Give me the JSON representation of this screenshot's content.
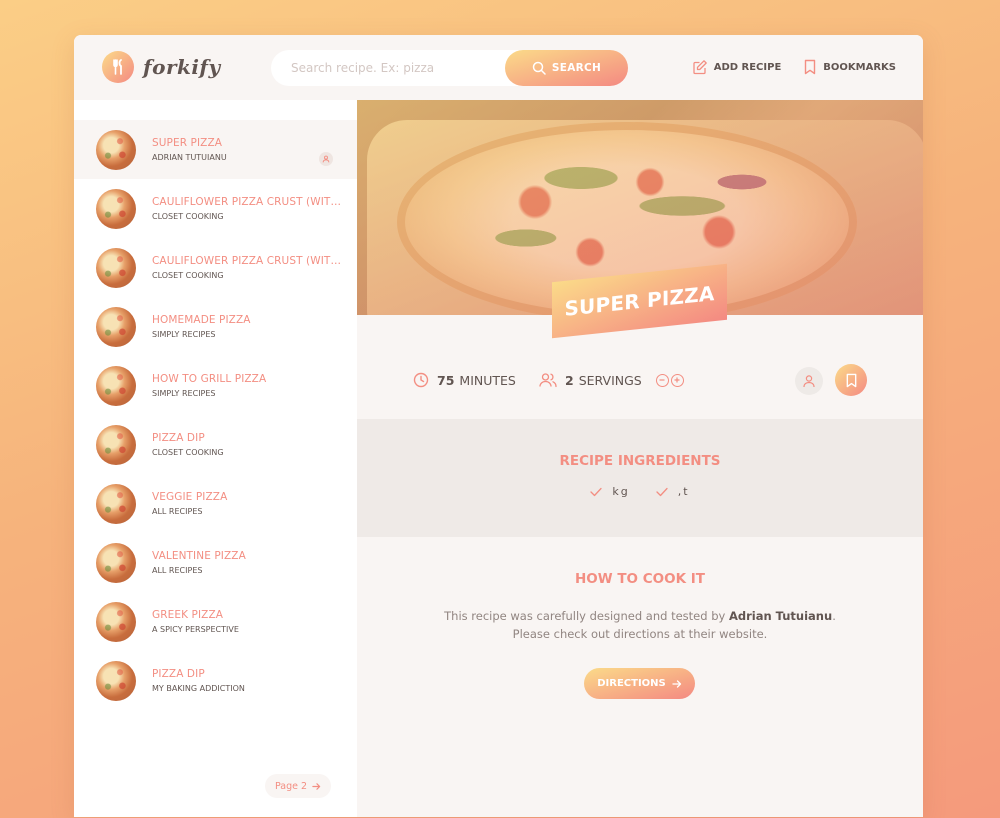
{
  "app": {
    "name": "forkify"
  },
  "colors": {
    "accent_start": "#fbdb89",
    "accent_end": "#f48982",
    "primary_text": "#615551",
    "title_pink": "#f38e82"
  },
  "search": {
    "placeholder": "Search recipe. Ex: pizza",
    "value": "",
    "button_label": "SEARCH"
  },
  "nav": {
    "add_recipe": "ADD RECIPE",
    "bookmarks": "BOOKMARKS"
  },
  "results": [
    {
      "title": "SUPER PIZZA",
      "publisher": "ADRIAN TUTUIANU",
      "active": true,
      "user_generated": true
    },
    {
      "title": "CAULIFLOWER PIZZA CRUST (WITH BBQ CHICKEN PIZZA)",
      "publisher": "CLOSET COOKING"
    },
    {
      "title": "CAULIFLOWER PIZZA CRUST (WITH BBQ CHICKEN PIZZA)",
      "publisher": "CLOSET COOKING"
    },
    {
      "title": "HOMEMADE PIZZA",
      "publisher": "SIMPLY RECIPES"
    },
    {
      "title": "HOW TO GRILL PIZZA",
      "publisher": "SIMPLY RECIPES"
    },
    {
      "title": "PIZZA DIP",
      "publisher": "CLOSET COOKING"
    },
    {
      "title": "VEGGIE PIZZA",
      "publisher": "ALL RECIPES"
    },
    {
      "title": "VALENTINE PIZZA",
      "publisher": "ALL RECIPES"
    },
    {
      "title": "GREEK PIZZA",
      "publisher": "A SPICY PERSPECTIVE"
    },
    {
      "title": "PIZZA DIP",
      "publisher": "MY BAKING ADDICTION"
    }
  ],
  "pagination": {
    "next_label": "Page 2"
  },
  "recipe": {
    "title": "SUPER PIZZA",
    "cooking_time": "75",
    "cooking_time_unit": "MINUTES",
    "servings": "2",
    "servings_unit": "SERVINGS",
    "ingredients_heading": "RECIPE INGREDIENTS",
    "ingredients": [
      {
        "text": "kg"
      },
      {
        "text": ",t"
      }
    ],
    "directions_heading": "HOW TO COOK IT",
    "directions_text_before": "This recipe was carefully designed and tested by ",
    "directions_publisher": "Adrian Tutuianu",
    "directions_text_after": ". Please check out directions at their website.",
    "directions_button": "DIRECTIONS"
  },
  "icons": {
    "logo": "fork-knife-icon",
    "search": "search-icon",
    "add_recipe": "edit-icon",
    "bookmarks": "bookmark-icon",
    "clock": "clock-icon",
    "users": "users-icon",
    "minus": "minus-circle-icon",
    "plus": "plus-circle-icon",
    "user": "user-icon",
    "bookmark_btn": "bookmark-icon",
    "check": "check-icon",
    "arrow": "arrow-right-icon"
  }
}
